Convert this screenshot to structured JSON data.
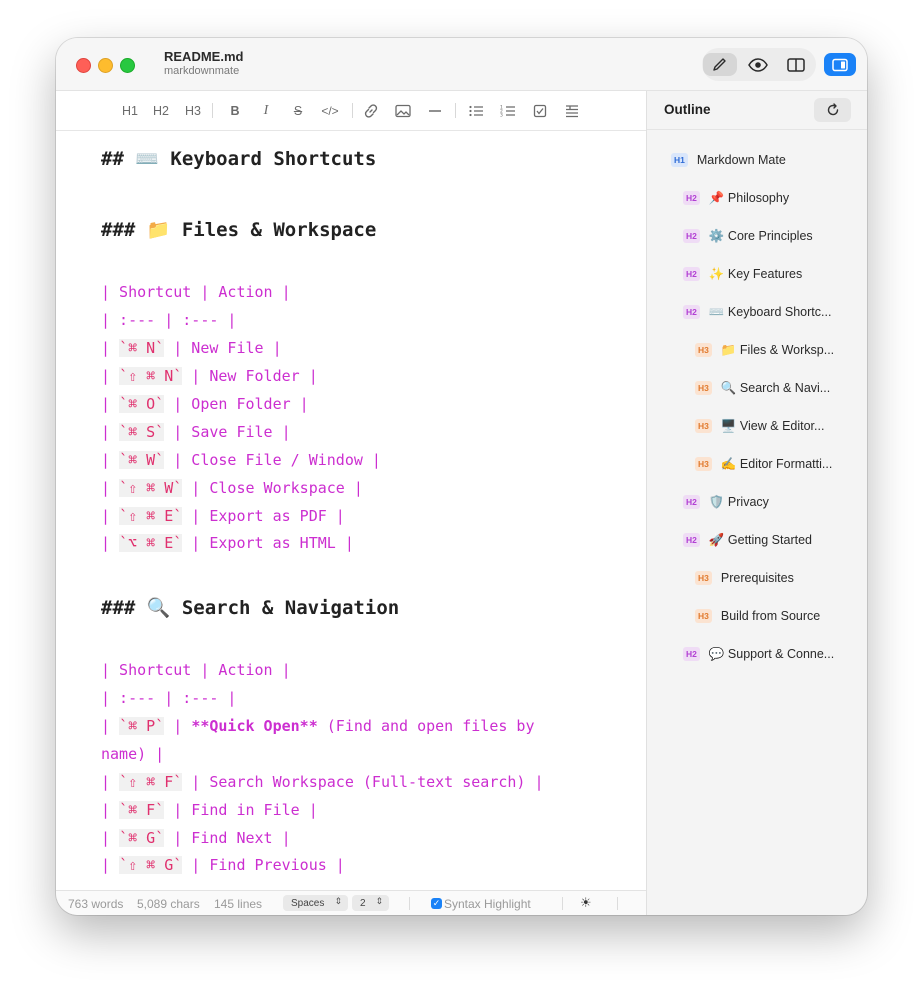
{
  "window": {
    "title": "README.md",
    "subtitle": "markdownmate"
  },
  "modes": [
    {
      "icon": "pencil-icon",
      "active": true
    },
    {
      "icon": "eye-icon",
      "active": false
    },
    {
      "icon": "split-view-icon",
      "active": false
    }
  ],
  "toolbar": {
    "h1": "H1",
    "h2": "H2",
    "h3": "H3",
    "bold": "B",
    "italic": "I",
    "strike": "S",
    "code": "</>"
  },
  "editor": {
    "lines": [
      "## ⌨️ Keyboard Shortcuts",
      "### 📁 Files & Workspace",
      "| Shortcut | Action |",
      "| :--- | :--- |",
      "| `⌘ N` | New File |",
      "| `⇧ ⌘ N` | New Folder |",
      "| `⌘ O` | Open Folder |",
      "| `⌘ S` | Save File |",
      "| `⌘ W` | Close File / Window |",
      "| `⇧ ⌘ W` | Close Workspace |",
      "| `⇧ ⌘ E` | Export as PDF |",
      "| `⌥ ⌘ E` | Export as HTML |",
      "### 🔍 Search & Navigation",
      "| Shortcut | Action |",
      "| :--- | :--- |",
      "| `⌘ P` | **Quick Open** (Find and open files by",
      "name) |",
      "| `⇧ ⌘ F` | Search Workspace (Full-text search) |",
      "| `⌘ F` | Find in File |",
      "| `⌘ G` | Find Next |",
      "| `⇧ ⌘ G` | Find Previous |"
    ]
  },
  "status": {
    "words": "763 words",
    "chars": "5,089 chars",
    "lines": "145 lines",
    "indent_type": "Spaces",
    "indent_size": "2",
    "syntax_label": "Syntax Highlight",
    "theme_icon": "☀"
  },
  "outline": {
    "title": "Outline",
    "items": [
      {
        "level": "H1",
        "text": "Markdown Mate"
      },
      {
        "level": "H2",
        "text": "📌 Philosophy"
      },
      {
        "level": "H2",
        "text": "⚙️ Core Principles"
      },
      {
        "level": "H2",
        "text": "✨ Key Features"
      },
      {
        "level": "H2",
        "text": "⌨️ Keyboard Shortc..."
      },
      {
        "level": "H3",
        "text": "📁 Files & Worksp..."
      },
      {
        "level": "H3",
        "text": "🔍 Search & Navi..."
      },
      {
        "level": "H3",
        "text": "🖥️ View & Editor..."
      },
      {
        "level": "H3",
        "text": "✍️ Editor Formatti..."
      },
      {
        "level": "H2",
        "text": "🛡️ Privacy"
      },
      {
        "level": "H2",
        "text": "🚀 Getting Started"
      },
      {
        "level": "H3",
        "text": "Prerequisites"
      },
      {
        "level": "H3",
        "text": "Build from Source"
      },
      {
        "level": "H2",
        "text": "💬 Support & Conne..."
      }
    ]
  }
}
